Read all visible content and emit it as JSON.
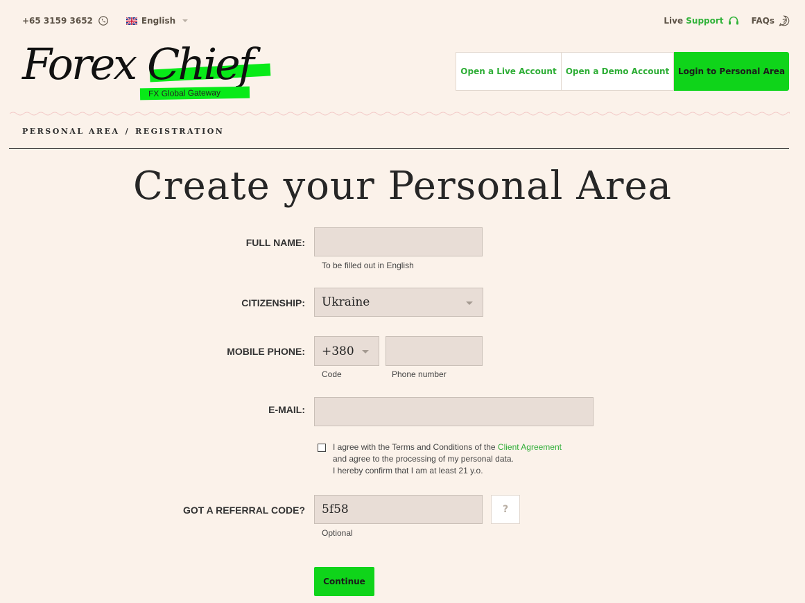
{
  "topbar": {
    "phone": "+65 3159 3652",
    "language": "English",
    "live_prefix": "Live",
    "live_support": "Support",
    "faqs": "FAQs"
  },
  "logo": {
    "name": "Forex Chief",
    "tagline": "FX Global Gateway"
  },
  "header_buttons": {
    "open_live": "Open a Live Account",
    "open_demo": "Open a Demo Account",
    "login": "Login to Personal Area"
  },
  "breadcrumb": {
    "part1": "PERSONAL AREA",
    "separator": "/",
    "part2": "REGISTRATION"
  },
  "page_title": "Create your Personal Area",
  "form": {
    "full_name": {
      "label": "FULL NAME:",
      "value": "",
      "hint": "To be filled out in English"
    },
    "citizenship": {
      "label": "CITIZENSHIP:",
      "value": "Ukraine"
    },
    "mobile_phone": {
      "label": "MOBILE PHONE:",
      "code_value": "+380",
      "code_hint": "Code",
      "number_value": "",
      "number_hint": "Phone number"
    },
    "email": {
      "label": "E-MAIL:",
      "value": ""
    },
    "agreement": {
      "line1_pre": "I agree with the Terms and Conditions of the ",
      "line1_link": "Client Agreement",
      "line2": "and agree to the processing of my personal data.",
      "line3": "I hereby confirm that I am at least 21 y.o.",
      "checked": false
    },
    "referral": {
      "label": "GOT A REFERRAL CODE?",
      "value": "5f58",
      "hint": "Optional",
      "help": "?"
    },
    "continue_label": "Continue"
  },
  "colors": {
    "background": "#fbf2ea",
    "accent_green": "#0fd41a",
    "link_green": "#2fae37",
    "field_bg": "#e8ddd6"
  }
}
